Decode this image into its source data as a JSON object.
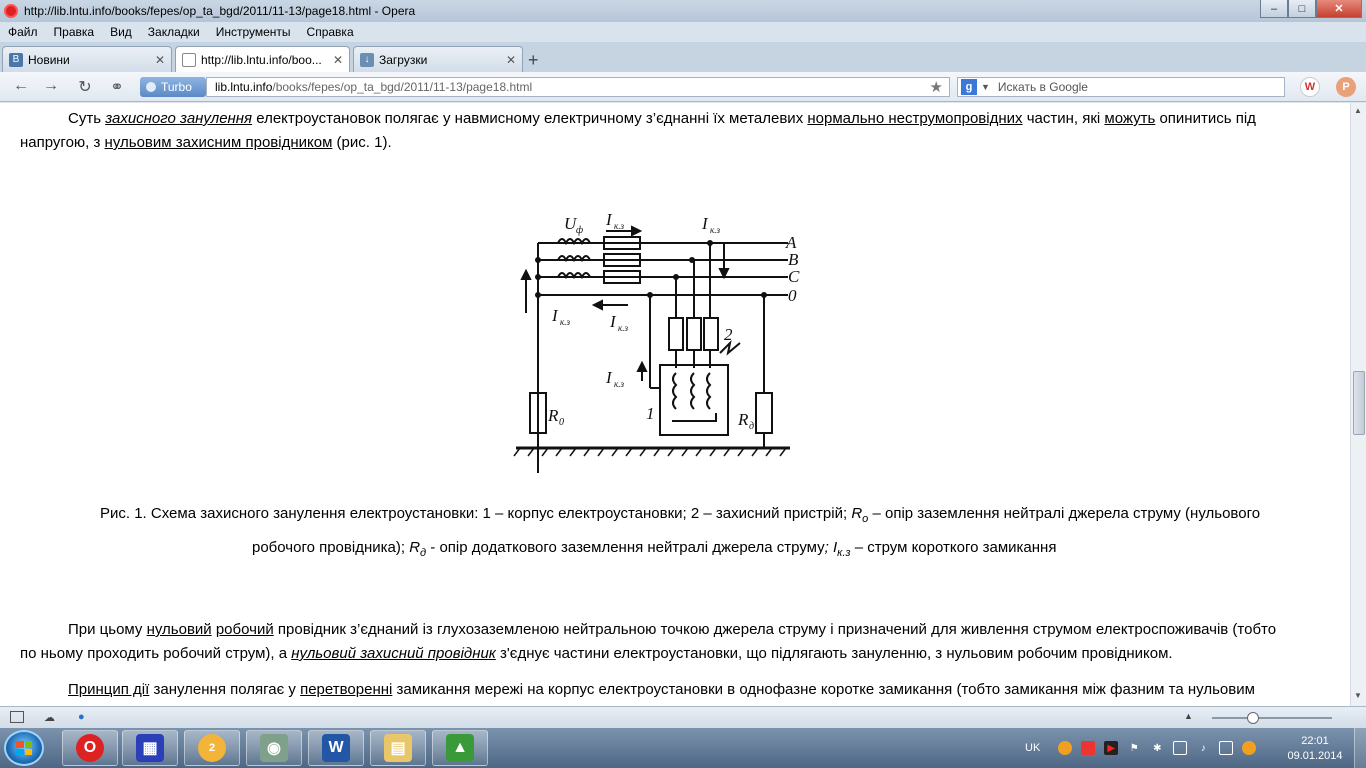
{
  "window": {
    "title": "http://lib.lntu.info/books/fepes/op_ta_bgd/2011/11-13/page18.html - Opera"
  },
  "menu": [
    "Файл",
    "Правка",
    "Вид",
    "Закладки",
    "Инструменты",
    "Справка"
  ],
  "tabs": [
    {
      "label": "Новини",
      "icon": "vk-icon"
    },
    {
      "label": "http://lib.lntu.info/boo...",
      "icon": "page-icon"
    },
    {
      "label": "Загрузки",
      "icon": "downloads-icon"
    }
  ],
  "address": {
    "turbo_label": "Turbo",
    "url_domain": "lib.lntu.info",
    "url_path": "/books/fepes/op_ta_bgd/2011/11-13/page18.html",
    "search_placeholder": "Искать в Google"
  },
  "content": {
    "p1": {
      "s1": "Суть ",
      "l1": "захисного занулення",
      "s2": " електроустановок полягає у навмисному електричному з’єднанні їх металевих ",
      "l2": "нормально неструмопровідних",
      "s3": " частин,  які ",
      "l3": "можуть",
      "s4": " опинитись під",
      "s5": "напругою, з ",
      "l4": "нульовим захисним провідником",
      "s6": " (рис. 1)."
    },
    "diagram": {
      "phase_labels": [
        "A",
        "B",
        "C",
        "0"
      ],
      "u_label": "U",
      "u_sub": "ф",
      "i_label": "I",
      "i_sub": "к.з",
      "r0_label": "R",
      "r0_sub": "0",
      "rd_label": "R",
      "rd_sub": "д",
      "num1": "1",
      "num2": "2"
    },
    "caption": {
      "line1a": "Рис. 1. Схема захисного занулення електроустановки: 1 – корпус електроустановки; 2 – захисний пристрій; ",
      "r": "R",
      "r_sub": "o",
      "line1b": " – опір заземлення нейтралі джерела струму (нульового",
      "line2a": "робочого провідника); ",
      "rd": "R",
      "rd_sub": "д",
      "line2b": "  - опір додаткового заземлення нейтралі джерела струму",
      "line2c": "; I",
      "i_sub": "к.з",
      "line2d": "  – струм короткого замикання"
    },
    "p2": {
      "s1": "При цьому ",
      "l1": "нульовий",
      "s2": " ",
      "l2": "робочий",
      "s3": " провідник з’єднаний із глухозаземленою нейтральною точкою джерела струму і призначений для живлення струмом електроспоживачів (тобто",
      "s4": "по ньому проходить робочий струм), а ",
      "l3": "нульовий захисний провідник",
      "s5": " з'єднує частини електроустановки, що підлягають зануленню, з нульовим робочим провідником."
    },
    "p3": {
      "l1": "Принцип дії",
      "s1": " занулення полягає у ",
      "l2": "перетворенні",
      "s2": " замикання мережі на корпус електроустановки в однофазне коротке замикання (тобто замикання між фазним та нульовим"
    }
  },
  "taskbar": {
    "language": "UK",
    "time": "22:01",
    "date": "09.01.2014",
    "weather_badge": "2"
  }
}
